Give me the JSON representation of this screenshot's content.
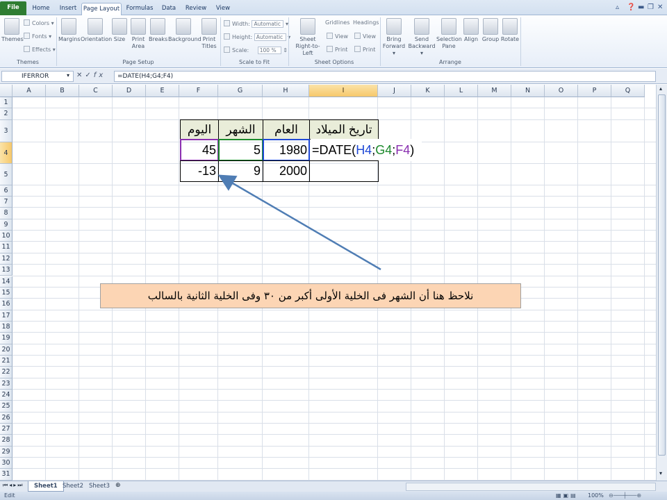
{
  "tabs": [
    "File",
    "Home",
    "Insert",
    "Page Layout",
    "Formulas",
    "Data",
    "Review",
    "View"
  ],
  "active_tab": "Page Layout",
  "ribbon": {
    "themes": {
      "themes": "Themes",
      "colors": "Colors",
      "fonts": "Fonts",
      "effects": "Effects",
      "group": "Themes"
    },
    "page_setup": {
      "margins": "Margins",
      "orientation": "Orientation",
      "size": "Size",
      "print_area_1": "Print",
      "print_area_2": "Area",
      "breaks": "Breaks",
      "background": "Background",
      "print_titles_1": "Print",
      "print_titles_2": "Titles",
      "group": "Page Setup"
    },
    "scale": {
      "width_label": "Width:",
      "width_value": "Automatic",
      "height_label": "Height:",
      "height_value": "Automatic",
      "scale_label": "Scale:",
      "scale_value": "100 %",
      "group": "Scale to Fit"
    },
    "sheet_options": {
      "sheet_rtl_1": "Sheet",
      "sheet_rtl_2": "Right-to-Left",
      "gridlines": "Gridlines",
      "headings": "Headings",
      "view": "View",
      "print": "Print",
      "group": "Sheet Options"
    },
    "arrange": {
      "bring_forward_1": "Bring",
      "bring_forward_2": "Forward",
      "send_backward_1": "Send",
      "send_backward_2": "Backward",
      "selection_pane_1": "Selection",
      "selection_pane_2": "Pane",
      "align": "Align",
      "group_btn": "Group",
      "rotate": "Rotate",
      "group": "Arrange"
    }
  },
  "formula_bar": {
    "name_box": "IFERROR",
    "formula": "=DATE(H4;G4;F4)"
  },
  "columns": [
    "A",
    "B",
    "C",
    "D",
    "E",
    "F",
    "G",
    "H",
    "I",
    "J",
    "K",
    "L",
    "M",
    "N",
    "O",
    "P",
    "Q"
  ],
  "rows": [
    "1",
    "2",
    "3",
    "4",
    "5",
    "6",
    "7",
    "8",
    "9",
    "10",
    "11",
    "12",
    "13",
    "14",
    "15",
    "16",
    "17",
    "18",
    "19",
    "20",
    "21",
    "22",
    "23",
    "24",
    "25",
    "26",
    "27",
    "28",
    "29",
    "30",
    "31"
  ],
  "table": {
    "headers": {
      "F": "اليوم",
      "G": "الشهر",
      "H": "العام",
      "I": "تاريخ الميلاد"
    },
    "row4": {
      "F": "45",
      "G": "5",
      "H": "1980"
    },
    "row5": {
      "F": "-13",
      "G": "9",
      "H": "2000"
    },
    "formula_parts": {
      "prefix": "=DATE(",
      "h": "H4",
      ";1": ";",
      "g": "G4",
      ";2": ";",
      "f": "F4",
      "suffix": ")"
    }
  },
  "callout": "نلاحظ هنا أن الشهر فى الخلية الأولى أكبر من ٣٠ وفى الخلية الثانية بالسالب",
  "sheets": [
    "Sheet1",
    "Sheet2",
    "Sheet3"
  ],
  "status": {
    "mode": "Edit",
    "zoom": "100%"
  },
  "colors": {
    "ref_h": "#1f49d6",
    "ref_g": "#1c8a2c",
    "ref_f": "#8a2fb0",
    "arrow": "#4f7db4"
  }
}
